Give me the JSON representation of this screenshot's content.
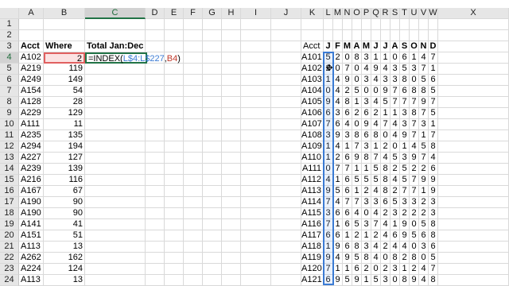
{
  "columns": [
    "A",
    "B",
    "C",
    "D",
    "E",
    "F",
    "G",
    "H",
    "I",
    "J",
    "K",
    "L",
    "M",
    "N",
    "O",
    "P",
    "Q",
    "R",
    "S",
    "T",
    "U",
    "V",
    "W",
    "X"
  ],
  "selected_column": "C",
  "selected_row": "4",
  "rows": [
    "1",
    "2",
    "3",
    "4",
    "5",
    "6",
    "7",
    "8",
    "9",
    "10",
    "11",
    "12",
    "13",
    "14",
    "15",
    "16",
    "17",
    "18",
    "19",
    "20",
    "21",
    "22",
    "23",
    "24",
    "25"
  ],
  "headers": {
    "acct": "Acct",
    "where": "Where",
    "total": "Total Jan:Dec"
  },
  "formula": {
    "prefix": "=INDEX(",
    "range": "L$4:L$227",
    "sep": ",",
    "ref": "B4",
    "suffix": ")"
  },
  "left_table": [
    {
      "acct": "A102",
      "where": "2"
    },
    {
      "acct": "A219",
      "where": "119"
    },
    {
      "acct": "A249",
      "where": "149"
    },
    {
      "acct": "A154",
      "where": "54"
    },
    {
      "acct": "A128",
      "where": "28"
    },
    {
      "acct": "A229",
      "where": "129"
    },
    {
      "acct": "A111",
      "where": "11"
    },
    {
      "acct": "A235",
      "where": "135"
    },
    {
      "acct": "A294",
      "where": "194"
    },
    {
      "acct": "A227",
      "where": "127"
    },
    {
      "acct": "A239",
      "where": "139"
    },
    {
      "acct": "A216",
      "where": "116"
    },
    {
      "acct": "A167",
      "where": "67"
    },
    {
      "acct": "A190",
      "where": "90"
    },
    {
      "acct": "A190",
      "where": "90"
    },
    {
      "acct": "A141",
      "where": "41"
    },
    {
      "acct": "A151",
      "where": "51"
    },
    {
      "acct": "A113",
      "where": "13"
    },
    {
      "acct": "A262",
      "where": "162"
    },
    {
      "acct": "A224",
      "where": "124"
    },
    {
      "acct": "A113",
      "where": "13"
    }
  ],
  "right_header": {
    "acct": "Acct",
    "months": [
      "J",
      "F",
      "M",
      "A",
      "M",
      "J",
      "J",
      "A",
      "S",
      "O",
      "N",
      "D"
    ]
  },
  "right_table": [
    {
      "acct": "A101",
      "v": [
        "5",
        "2",
        "0",
        "8",
        "3",
        "1",
        "1",
        "0",
        "6",
        "1",
        "4",
        "7"
      ]
    },
    {
      "acct": "A102",
      "v": [
        "2",
        "0",
        "7",
        "0",
        "4",
        "9",
        "4",
        "3",
        "5",
        "3",
        "7",
        "1"
      ]
    },
    {
      "acct": "A103",
      "v": [
        "1",
        "4",
        "9",
        "0",
        "3",
        "4",
        "3",
        "3",
        "8",
        "0",
        "5",
        "6"
      ]
    },
    {
      "acct": "A104",
      "v": [
        "0",
        "4",
        "2",
        "5",
        "0",
        "0",
        "9",
        "7",
        "6",
        "8",
        "8",
        "5"
      ]
    },
    {
      "acct": "A105",
      "v": [
        "9",
        "4",
        "8",
        "1",
        "3",
        "4",
        "5",
        "7",
        "7",
        "7",
        "9",
        "7"
      ]
    },
    {
      "acct": "A106",
      "v": [
        "6",
        "3",
        "6",
        "2",
        "6",
        "2",
        "1",
        "1",
        "3",
        "8",
        "7",
        "5"
      ]
    },
    {
      "acct": "A107",
      "v": [
        "7",
        "6",
        "4",
        "0",
        "9",
        "4",
        "7",
        "4",
        "3",
        "7",
        "3",
        "1"
      ]
    },
    {
      "acct": "A108",
      "v": [
        "3",
        "9",
        "3",
        "8",
        "6",
        "8",
        "0",
        "4",
        "9",
        "7",
        "1",
        "7"
      ]
    },
    {
      "acct": "A109",
      "v": [
        "1",
        "4",
        "1",
        "7",
        "3",
        "1",
        "2",
        "0",
        "1",
        "4",
        "5",
        "8"
      ]
    },
    {
      "acct": "A110",
      "v": [
        "1",
        "2",
        "6",
        "9",
        "8",
        "7",
        "4",
        "5",
        "3",
        "9",
        "7",
        "4"
      ]
    },
    {
      "acct": "A111",
      "v": [
        "0",
        "7",
        "7",
        "1",
        "1",
        "5",
        "8",
        "2",
        "5",
        "2",
        "2",
        "6"
      ]
    },
    {
      "acct": "A112",
      "v": [
        "4",
        "1",
        "6",
        "5",
        "5",
        "5",
        "8",
        "4",
        "5",
        "7",
        "9",
        "9"
      ]
    },
    {
      "acct": "A113",
      "v": [
        "9",
        "5",
        "6",
        "1",
        "2",
        "4",
        "8",
        "2",
        "7",
        "7",
        "1",
        "9"
      ]
    },
    {
      "acct": "A114",
      "v": [
        "7",
        "4",
        "7",
        "7",
        "3",
        "3",
        "6",
        "5",
        "3",
        "3",
        "2",
        "3"
      ]
    },
    {
      "acct": "A115",
      "v": [
        "3",
        "6",
        "6",
        "4",
        "0",
        "4",
        "2",
        "3",
        "2",
        "2",
        "2",
        "3"
      ]
    },
    {
      "acct": "A116",
      "v": [
        "7",
        "1",
        "6",
        "5",
        "3",
        "7",
        "4",
        "1",
        "9",
        "0",
        "5",
        "8"
      ]
    },
    {
      "acct": "A117",
      "v": [
        "6",
        "6",
        "1",
        "2",
        "1",
        "2",
        "4",
        "6",
        "9",
        "5",
        "6",
        "8"
      ]
    },
    {
      "acct": "A118",
      "v": [
        "1",
        "9",
        "6",
        "8",
        "3",
        "4",
        "2",
        "4",
        "4",
        "0",
        "3",
        "6"
      ]
    },
    {
      "acct": "A119",
      "v": [
        "9",
        "4",
        "9",
        "5",
        "8",
        "4",
        "0",
        "8",
        "2",
        "8",
        "0",
        "5"
      ]
    },
    {
      "acct": "A120",
      "v": [
        "7",
        "1",
        "1",
        "6",
        "2",
        "0",
        "2",
        "3",
        "1",
        "2",
        "4",
        "7"
      ]
    },
    {
      "acct": "A121",
      "v": [
        "6",
        "9",
        "5",
        "9",
        "1",
        "5",
        "3",
        "0",
        "8",
        "9",
        "4",
        "8"
      ]
    }
  ]
}
